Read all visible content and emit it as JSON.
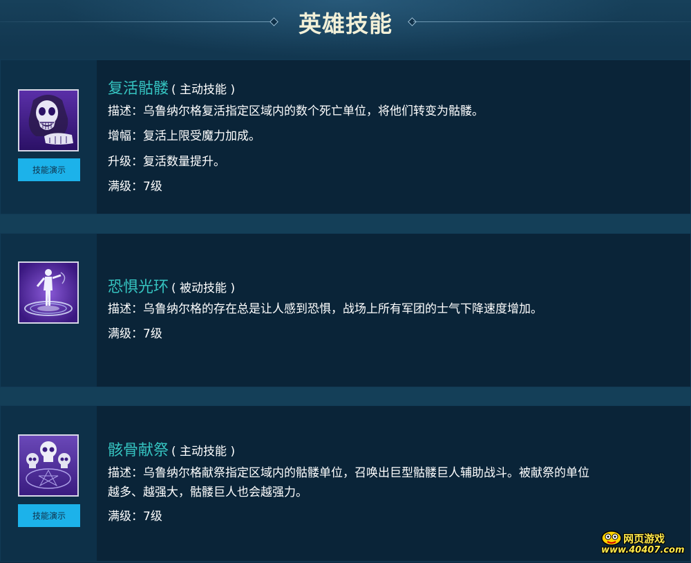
{
  "page": {
    "title": "英雄技能"
  },
  "skills": [
    {
      "name": "复活骷髅",
      "type": "( 主动技能 )",
      "lines": [
        "描述：乌鲁纳尔格复活指定区域内的数个死亡单位，将他们转变为骷髅。",
        "增幅：复活上限受魔力加成。",
        "升级：复活数量提升。",
        "满级：7级"
      ],
      "demo_label": "技能演示",
      "icon": "skull-reaper-icon"
    },
    {
      "name": "恐惧光环",
      "type": "( 被动技能 )",
      "lines": [
        "描述：乌鲁纳尔格的存在总是让人感到恐惧，战场上所有军团的士气下降速度增加。",
        "满级：7级"
      ],
      "icon": "fear-aura-icon"
    },
    {
      "name": "骸骨献祭",
      "type": "( 主动技能 )",
      "lines": [
        "描述：乌鲁纳尔格献祭指定区域内的骷髅单位，召唤出巨型骷髅巨人辅助战斗。被献祭的单位",
        "越多、越强大，骷髅巨人也会越强力。",
        "满级：7级"
      ],
      "demo_label": "技能演示",
      "icon": "bone-sacrifice-icon"
    }
  ],
  "watermark": {
    "top": "网页游戏",
    "bottom": "www.40407.com"
  },
  "colors": {
    "accent": "#35c3c0",
    "button": "#1cb2ea",
    "title": "#f2f0d8"
  }
}
